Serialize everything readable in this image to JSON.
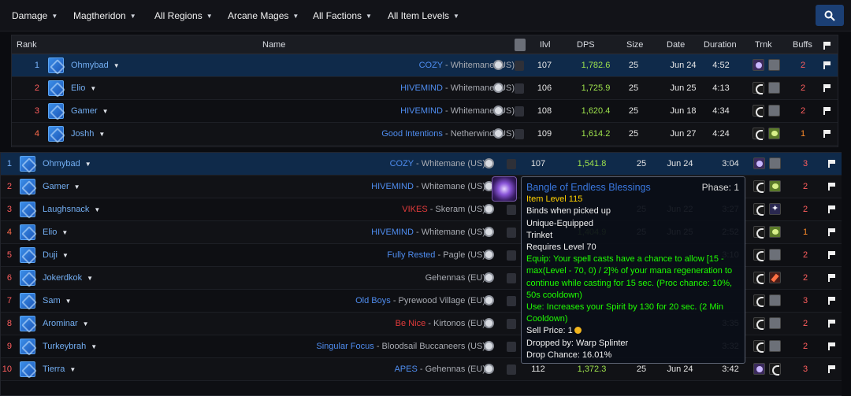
{
  "filters": [
    {
      "label": "Damage"
    },
    {
      "label": "Magtheridon"
    },
    {
      "label": "All Regions"
    },
    {
      "label": "Arcane Mages"
    },
    {
      "label": "All Factions"
    },
    {
      "label": "All Item Levels"
    }
  ],
  "search_icon": "search-icon",
  "columns": {
    "rank": "Rank",
    "name": "Name",
    "ilvl": "Ilvl",
    "dps": "DPS",
    "size": "Size",
    "date": "Date",
    "duration": "Duration",
    "trnk": "Trnk",
    "buffs": "Buffs"
  },
  "top_rows": [
    {
      "rank": "1",
      "name": "Ohmybad",
      "guild": "COZY",
      "realm": " - Whitemane (US)",
      "ilvl": "107",
      "dps": "1,782.6",
      "size": "25",
      "date": "Jun 24",
      "duration": "4:52",
      "buffs": "2",
      "trinkets": [
        "orb",
        "grey"
      ]
    },
    {
      "rank": "2",
      "name": "Elio",
      "guild": "HIVEMIND",
      "realm": " - Whitemane (US)",
      "ilvl": "106",
      "dps": "1,725.9",
      "size": "25",
      "date": "Jun 25",
      "duration": "4:13",
      "buffs": "2",
      "trinkets": [
        "claw",
        "grey"
      ]
    },
    {
      "rank": "3",
      "name": "Gamer",
      "guild": "HIVEMIND",
      "realm": " - Whitemane (US)",
      "ilvl": "108",
      "dps": "1,620.4",
      "size": "25",
      "date": "Jun 18",
      "duration": "4:34",
      "buffs": "2",
      "trinkets": [
        "claw",
        "grey"
      ]
    },
    {
      "rank": "4",
      "name": "Joshh",
      "guild": "Good Intentions",
      "realm": " - Netherwind (US)",
      "ilvl": "109",
      "dps": "1,614.2",
      "size": "25",
      "date": "Jun 27",
      "duration": "4:24",
      "buffs": "1",
      "trinkets": [
        "claw",
        "green"
      ]
    }
  ],
  "main_rows": [
    {
      "rank": "1",
      "name": "Ohmybad",
      "guild": "COZY",
      "realm": " - Whitemane (US)",
      "ilvl": "107",
      "dps": "1,541.8",
      "size": "25",
      "date": "Jun 24",
      "duration": "3:04",
      "buffs": "3",
      "trinkets": [
        "orb",
        "grey"
      ]
    },
    {
      "rank": "2",
      "name": "Gamer",
      "guild": "HIVEMIND",
      "realm": " - Whitemane (US)",
      "ilvl": "",
      "dps": "",
      "size": "",
      "date": "",
      "duration": "",
      "buffs": "2",
      "trinkets": [
        "claw",
        "green"
      ]
    },
    {
      "rank": "3",
      "name": "Laughsnack",
      "guild": "VIKES",
      "realm": " - Skeram (US)",
      "ilvl": "",
      "dps": "",
      "size": "25",
      "date": "Jun 22",
      "duration": "3:27",
      "buffs": "2",
      "trinkets": [
        "claw",
        "star"
      ]
    },
    {
      "rank": "4",
      "name": "Elio",
      "guild": "HIVEMIND",
      "realm": " - Whitemane (US)",
      "ilvl": "",
      "dps": "1,404.9",
      "size": "25",
      "date": "Jun 25",
      "duration": "2:52",
      "buffs": "1",
      "trinkets": [
        "claw",
        "green"
      ]
    },
    {
      "rank": "5",
      "name": "Duji",
      "guild": "Fully Rested",
      "realm": " - Pagle (US)",
      "ilvl": "",
      "dps": "",
      "size": "",
      "date": "",
      "duration": "3:10",
      "buffs": "2",
      "trinkets": [
        "claw",
        "grey"
      ]
    },
    {
      "rank": "6",
      "name": "Jokerdkok",
      "guild": "",
      "realm": "Gehennas (EU)",
      "ilvl": "",
      "dps": "",
      "size": "",
      "date": "",
      "duration": "",
      "buffs": "2",
      "trinkets": [
        "claw",
        "red"
      ]
    },
    {
      "rank": "7",
      "name": "Sam",
      "guild": "Old Boys",
      "realm": " - Pyrewood Village (EU)",
      "ilvl": "",
      "dps": "",
      "size": "",
      "date": "",
      "duration": "",
      "buffs": "3",
      "trinkets": [
        "claw",
        "grey"
      ]
    },
    {
      "rank": "8",
      "name": "Arominar",
      "guild": "Be Nice",
      "realm": " - Kirtonos (EU)",
      "ilvl": "",
      "dps": "",
      "size": "",
      "date": "",
      "duration": "3:35",
      "buffs": "2",
      "trinkets": [
        "claw",
        "grey"
      ]
    },
    {
      "rank": "9",
      "name": "Turkeybrah",
      "guild": "Singular Focus",
      "realm": " - Bloodsail Buccaneers (US)",
      "ilvl": "",
      "dps": "",
      "size": "",
      "date": "",
      "duration": "3:32",
      "buffs": "2",
      "trinkets": [
        "claw",
        "grey"
      ]
    },
    {
      "rank": "10",
      "name": "Tierra",
      "guild": "APES",
      "realm": " - Gehennas (EU)",
      "ilvl": "112",
      "dps": "1,372.3",
      "size": "25",
      "date": "Jun 24",
      "duration": "3:42",
      "buffs": "3",
      "trinkets": [
        "orb",
        "claw"
      ]
    }
  ],
  "tooltip": {
    "title": "Bangle of Endless Blessings",
    "phase": "Phase: 1",
    "item_level": "Item Level 115",
    "binds": "Binds when picked up",
    "unique": "Unique-Equipped",
    "slot": "Trinket",
    "requires": "Requires Level 70",
    "equip": "Equip: Your spell casts have a chance to allow [15 - max(Level - 70, 0) / 2]% of your mana regeneration to continue while casting for 15 sec. (Proc chance: 10%, 50s cooldown)",
    "use": "Use: Increases your Spirit by 130 for 20 sec. (2 Min Cooldown)",
    "sell_price": "Sell Price: 1",
    "dropped_by": "Dropped by: Warp Splinter",
    "drop_chance": "Drop Chance: 16.01%"
  }
}
